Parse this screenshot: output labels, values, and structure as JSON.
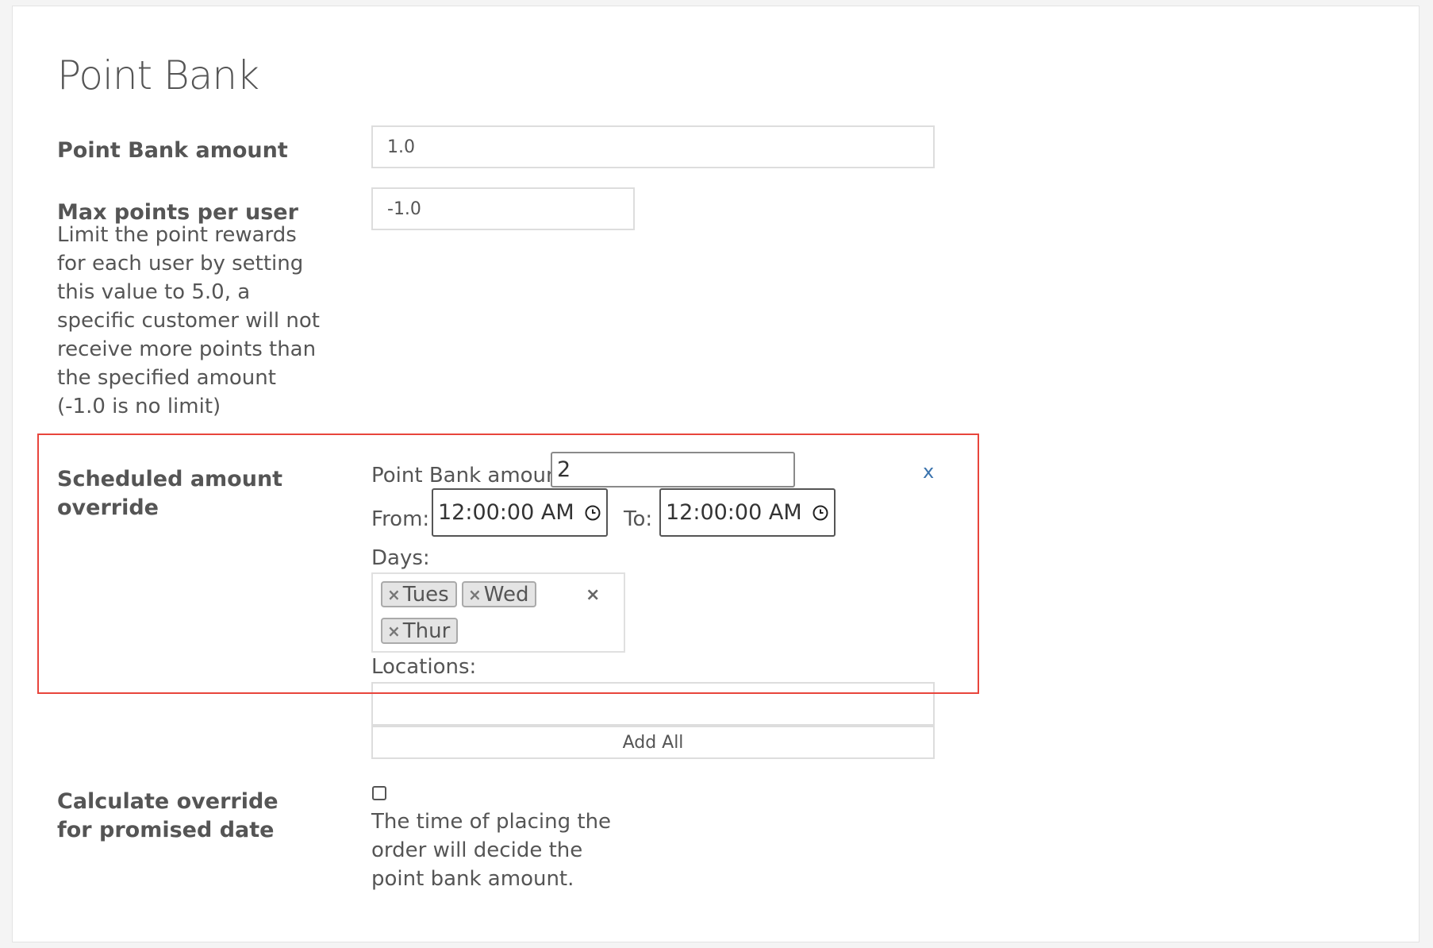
{
  "page_title": "Point Bank",
  "point_bank_amount": {
    "label": "Point Bank amount",
    "value": "1.0"
  },
  "max_points": {
    "label": "Max points per user",
    "description": "Limit the point rewards for each user by setting this value to 5.0, a specific customer will not receive more points than the specified amount (-1.0 is no limit)",
    "value": "-1.0"
  },
  "scheduled_override": {
    "label": "Scheduled amount override",
    "amount_label": "Point Bank amount:",
    "amount_value": "2",
    "remove_label": "x",
    "from_label": "From:",
    "from_time": "12:00:00 AM",
    "to_label": "To:",
    "to_time": "12:00:00 AM",
    "days_label": "Days:",
    "days": [
      "Tues",
      "Wed",
      "Thur"
    ],
    "tag_remove_glyph": "×",
    "clear_days_glyph": "×",
    "locations_label": "Locations:",
    "add_all_label": "Add All"
  },
  "promised_date": {
    "label": "Calculate override for promised date",
    "checked": false,
    "help_text": "The time of placing the order will decide the point bank amount."
  },
  "colors": {
    "highlight_border": "#e8453c",
    "link_blue": "#3a73ad",
    "text": "#555555"
  },
  "icons": {
    "time_picker": "clock-icon",
    "remove_override": "close-icon",
    "remove_tag": "close-icon"
  }
}
